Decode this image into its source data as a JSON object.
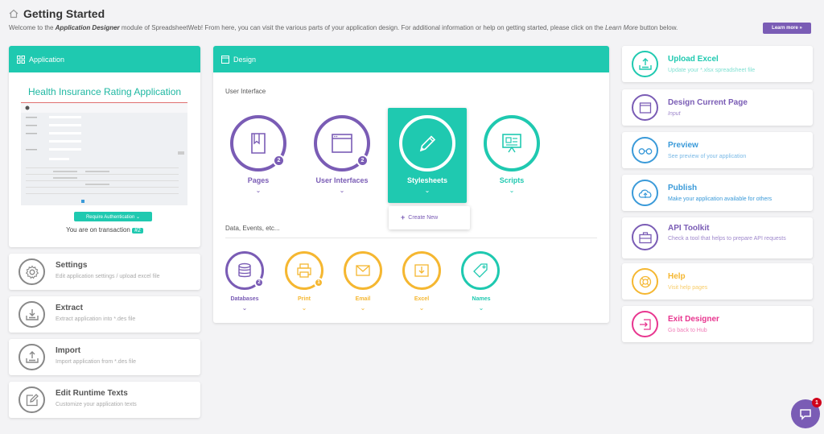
{
  "header": {
    "title": "Getting Started",
    "welcome_prefix": "Welcome to the ",
    "welcome_module": "Application Designer",
    "welcome_mid": " module of SpreadsheetWeb! From here, you can visit the various parts of your application design. For additional information or help on getting started, please click on the ",
    "welcome_learn": "Learn More",
    "welcome_suffix": " button below.",
    "learn_button": "Learn more »"
  },
  "application": {
    "header": "Application",
    "name": "Health Insurance Rating Application",
    "auth_button": "Require Authentication ⌄",
    "transaction_text": "You are on transaction ",
    "transaction_number": "#2"
  },
  "left_items": [
    {
      "title": "Settings",
      "subtitle": "Edit application settings / upload excel file",
      "icon": "gear-icon"
    },
    {
      "title": "Extract",
      "subtitle": "Extract application into *.des file",
      "icon": "download-tray-icon"
    },
    {
      "title": "Import",
      "subtitle": "Import application from *.des file",
      "icon": "upload-tray-icon"
    },
    {
      "title": "Edit Runtime Texts",
      "subtitle": "Customize your application texts",
      "icon": "pencil-square-icon"
    }
  ],
  "design": {
    "header": "Design",
    "ui_section": "User Interface",
    "data_section": "Data, Events, etc...",
    "ui_items": [
      {
        "label": "Pages",
        "badge": "2",
        "icon": "book-icon"
      },
      {
        "label": "User Interfaces",
        "badge": "2",
        "icon": "browser-window-icon"
      },
      {
        "label": "Stylesheets",
        "badge": "",
        "icon": "pen-icon"
      },
      {
        "label": "Scripts",
        "badge": "",
        "icon": "presentation-icon"
      }
    ],
    "create_new": "Create New",
    "data_items": [
      {
        "label": "Databases",
        "badge": "2",
        "icon": "database-icon"
      },
      {
        "label": "Print",
        "badge": "1",
        "icon": "printer-icon"
      },
      {
        "label": "Email",
        "badge": "",
        "icon": "envelope-icon"
      },
      {
        "label": "Excel",
        "badge": "",
        "icon": "excel-download-icon"
      },
      {
        "label": "Names",
        "badge": "",
        "icon": "tag-icon"
      }
    ]
  },
  "right_items": [
    {
      "title": "Upload Excel",
      "subtitle": "Update your *.xlsx spreadsheet file",
      "color": "#1fc9b0",
      "icon": "upload-tray-icon"
    },
    {
      "title": "Design Current Page",
      "subtitle": "Input",
      "color": "#7a5cb5",
      "icon": "browser-window-icon"
    },
    {
      "title": "Preview",
      "subtitle": "See preview of your application",
      "color": "#3a9ad9",
      "icon": "glasses-icon"
    },
    {
      "title": "Publish",
      "subtitle": "Make your application available for others",
      "color": "#3a9ad9",
      "icon": "cloud-upload-icon"
    },
    {
      "title": "API Toolkit",
      "subtitle": "Check a tool that helps to prepare API requests",
      "color": "#7a5cb5",
      "icon": "toolbox-icon"
    },
    {
      "title": "Help",
      "subtitle": "Visit help pages",
      "color": "#f5b731",
      "icon": "lifebuoy-icon"
    },
    {
      "title": "Exit Designer",
      "subtitle": "Go back to Hub",
      "color": "#e8358f",
      "icon": "exit-icon"
    }
  ],
  "chat": {
    "count": "1",
    "icon": "chat-bubble-icon"
  },
  "colors": {
    "teal": "#1fc9b0",
    "purple": "#7a5cb5",
    "orange": "#f5b731",
    "blue": "#3a9ad9",
    "pink": "#e8358f"
  }
}
